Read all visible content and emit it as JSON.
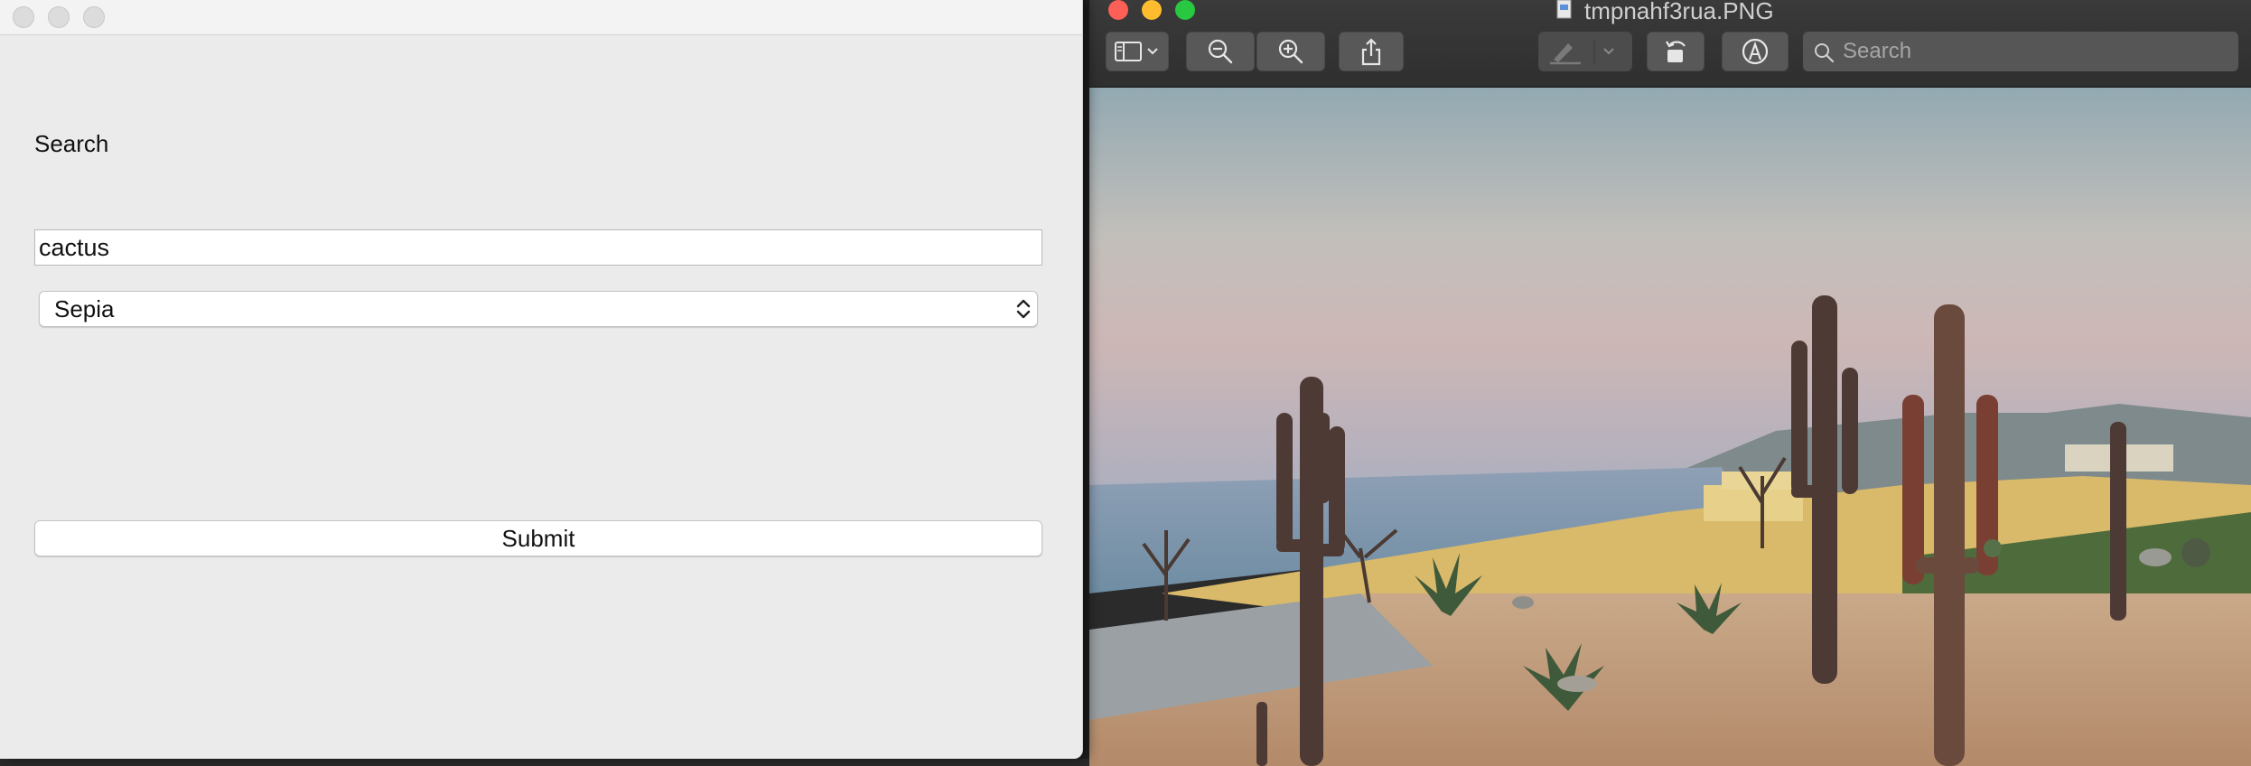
{
  "form_window": {
    "search_label": "Search",
    "search_value": "cactus",
    "filter_selected": "Sepia",
    "submit_label": "Submit"
  },
  "preview_window": {
    "file_name": "tmpnahf3rua.PNG",
    "search_placeholder": "Search",
    "toolbar_icons": [
      "sidebar-icon",
      "chevron-down-icon",
      "zoom-out-icon",
      "zoom-in-icon",
      "share-icon",
      "highlight-pen-icon",
      "rotate-icon",
      "markup-icon",
      "search-icon"
    ]
  },
  "colors": {
    "close": "#fe5f57",
    "minimize": "#febc2e",
    "maximize": "#28c840"
  }
}
